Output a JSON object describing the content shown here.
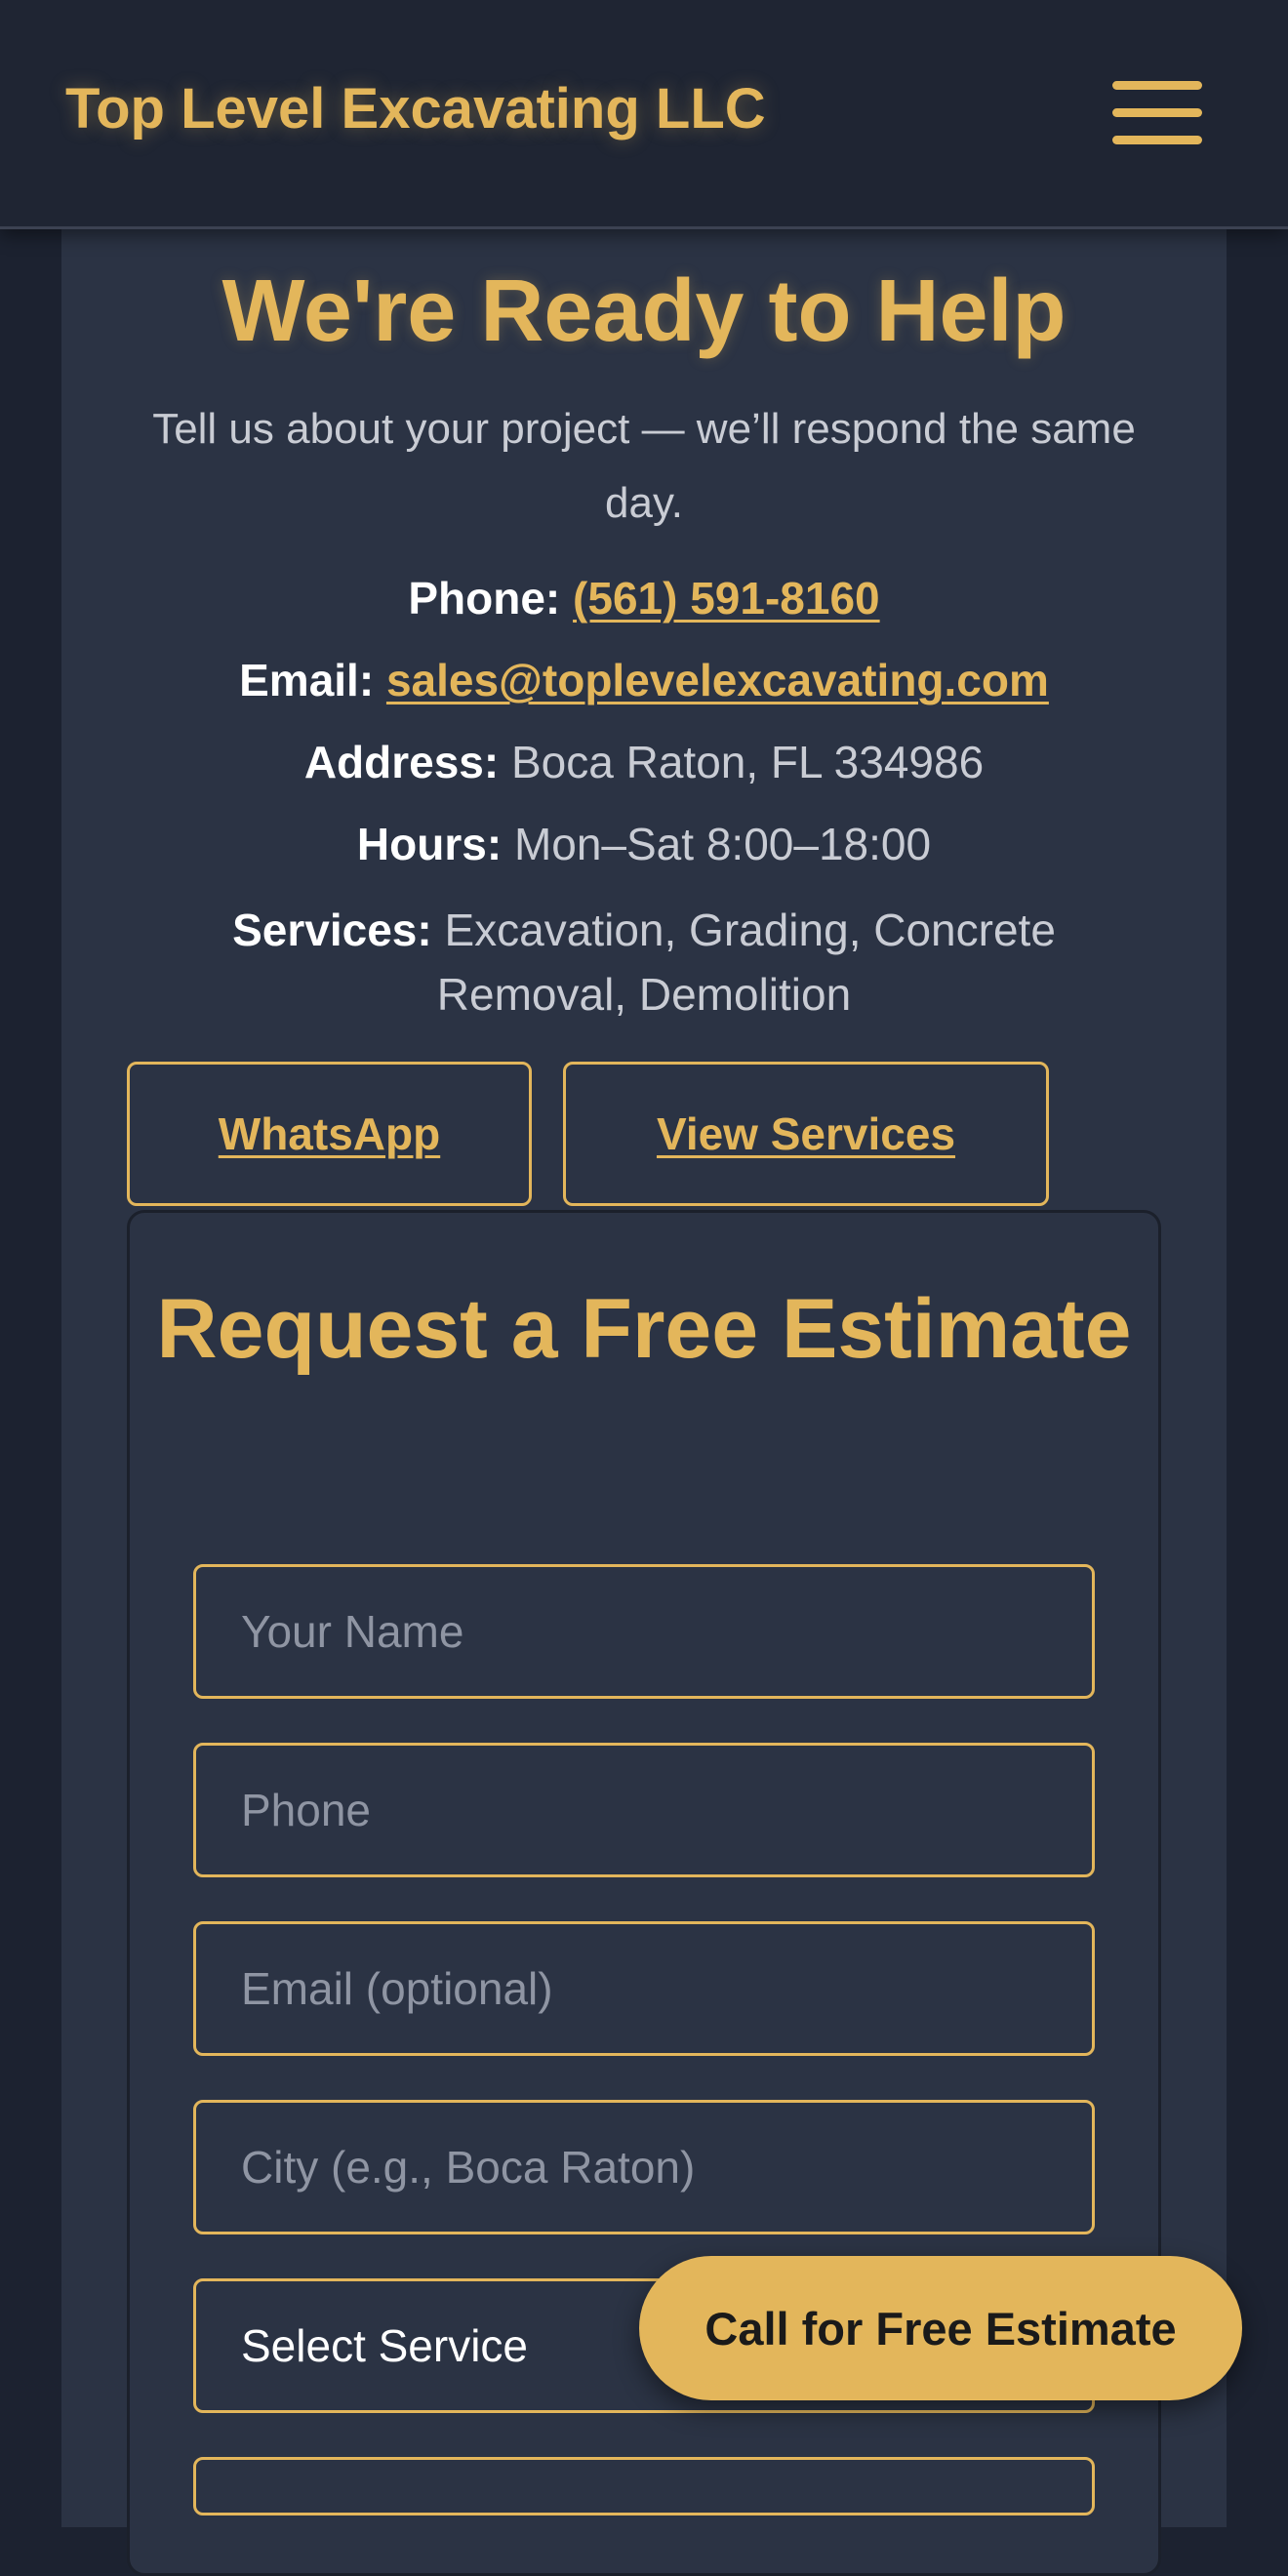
{
  "header": {
    "brand": "Top Level Excavating LLC",
    "menu_icon": "hamburger-menu-icon"
  },
  "hero": {
    "title": "We're Ready to Help",
    "subtitle": "Tell us about your project — we’ll respond the same day."
  },
  "contact": {
    "phone_label": "Phone:",
    "phone_value": "(561) 591-8160",
    "email_label": "Email:",
    "email_value": "sales@toplevelexcavating.com",
    "address_label": "Address:",
    "address_value": "Boca Raton, FL 334986",
    "hours_label": "Hours:",
    "hours_value": "Mon–Sat 8:00–18:00",
    "services_label": "Services:",
    "services_value": "Excavation, Grading, Concrete Removal, Demolition"
  },
  "buttons": {
    "whatsapp": "WhatsApp",
    "view_services": "View Services"
  },
  "form": {
    "title": "Request a Free Estimate",
    "name_placeholder": "Your Name",
    "phone_placeholder": "Phone",
    "email_placeholder": "Email (optional)",
    "city_placeholder": "City (e.g., Boca Raton)",
    "service_select_value": "Select Service"
  },
  "floating_cta": {
    "label": "Call for Free Estimate"
  },
  "colors": {
    "accent": "#e3b65b",
    "page_background": "#1c2230",
    "card_background": "#2b3344",
    "header_background": "#1f2533"
  }
}
